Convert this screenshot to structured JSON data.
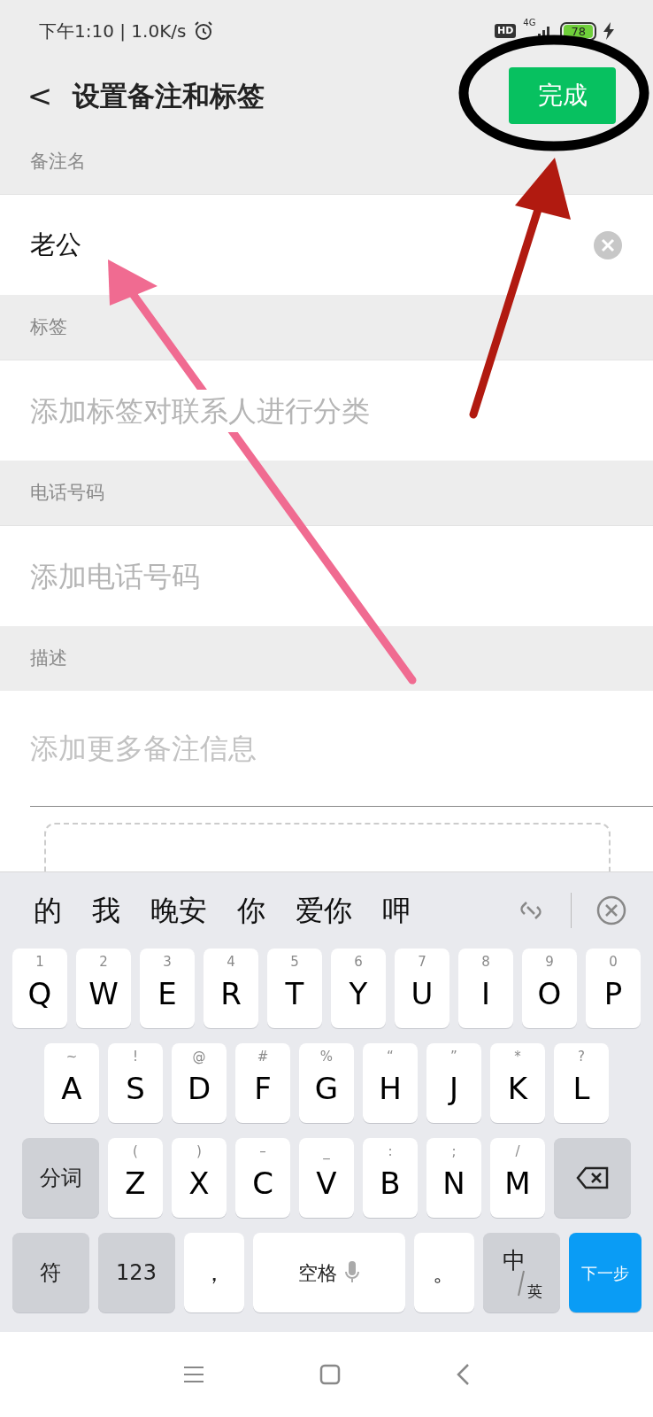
{
  "status_bar": {
    "time": "下午1:10 | 1.0K/s",
    "hd": "HD",
    "network": "4G",
    "battery": "78",
    "charging": true
  },
  "header": {
    "back": "<",
    "title": "设置备注和标签",
    "done_button": "完成"
  },
  "sections": [
    {
      "label": "备注名",
      "value": "老公",
      "clearable": true,
      "kind": "line"
    },
    {
      "label": "标签",
      "placeholder": "添加标签对联系人进行分类",
      "kind": "line"
    },
    {
      "label": "电话号码",
      "placeholder": "添加电话号码",
      "kind": "line"
    },
    {
      "label": "描述",
      "placeholder": "添加更多备注信息",
      "kind": "area"
    }
  ],
  "keyboard": {
    "candidates": [
      "的",
      "我",
      "晚安",
      "你",
      "爱你",
      "呷"
    ],
    "top_row": [
      {
        "kind": "letter",
        "label": "Q",
        "hint": "1"
      },
      {
        "kind": "letter",
        "label": "W",
        "hint": "2"
      },
      {
        "kind": "letter",
        "label": "E",
        "hint": "3"
      },
      {
        "kind": "letter",
        "label": "R",
        "hint": "4"
      },
      {
        "kind": "letter",
        "label": "T",
        "hint": "5"
      },
      {
        "kind": "letter",
        "label": "Y",
        "hint": "6"
      },
      {
        "kind": "letter",
        "label": "U",
        "hint": "7"
      },
      {
        "kind": "letter",
        "label": "I",
        "hint": "8"
      },
      {
        "kind": "letter",
        "label": "O",
        "hint": "9"
      },
      {
        "kind": "letter",
        "label": "P",
        "hint": "0"
      }
    ],
    "home_row": [
      {
        "kind": "letter",
        "label": "A",
        "hint": "~"
      },
      {
        "kind": "letter",
        "label": "S",
        "hint": "!"
      },
      {
        "kind": "letter",
        "label": "D",
        "hint": "@"
      },
      {
        "kind": "letter",
        "label": "F",
        "hint": "#"
      },
      {
        "kind": "letter",
        "label": "G",
        "hint": "%"
      },
      {
        "kind": "letter",
        "label": "H",
        "hint": "“"
      },
      {
        "kind": "letter",
        "label": "J",
        "hint": "”"
      },
      {
        "kind": "letter",
        "label": "K",
        "hint": "*"
      },
      {
        "kind": "letter",
        "label": "L",
        "hint": "?"
      }
    ],
    "bottom_row": [
      {
        "kind": "function",
        "label": "分词"
      },
      {
        "kind": "letter",
        "label": "Z",
        "hint": "("
      },
      {
        "kind": "letter",
        "label": "X",
        "hint": ")"
      },
      {
        "kind": "letter",
        "label": "C",
        "hint": "–"
      },
      {
        "kind": "letter",
        "label": "V",
        "hint": "_"
      },
      {
        "kind": "letter",
        "label": "B",
        "hint": ":"
      },
      {
        "kind": "letter",
        "label": "N",
        "hint": ";"
      },
      {
        "kind": "letter",
        "label": "M",
        "hint": "/"
      },
      {
        "kind": "backspace"
      }
    ],
    "function_row": [
      {
        "kind": "function",
        "label": "符"
      },
      {
        "kind": "function",
        "label": "123"
      },
      {
        "kind": "punct",
        "label": "，"
      },
      {
        "kind": "space",
        "label": "空格"
      },
      {
        "kind": "punct",
        "label": "。"
      },
      {
        "kind": "lang",
        "label": "中",
        "sub": "英"
      },
      {
        "kind": "action",
        "label": "下一步"
      }
    ]
  }
}
